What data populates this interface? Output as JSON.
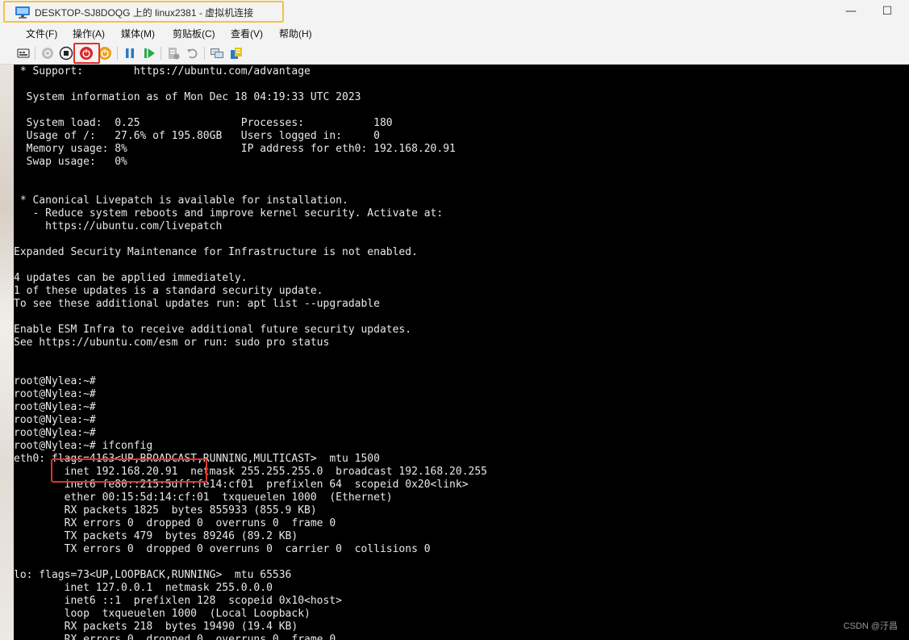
{
  "window": {
    "title": "DESKTOP-SJ8DOQG 上的 linux2381 - 虚拟机连接",
    "controls": {
      "minimize": "—",
      "maximize": "☐"
    }
  },
  "menu": [
    "文件(F)",
    "操作(A)",
    "媒体(M)",
    "剪贴板(C)",
    "查看(V)",
    "帮助(H)"
  ],
  "toolbar": {
    "buttons": [
      "ctrl-alt-del-icon",
      "start-icon",
      "turn-off-icon",
      "shutdown-icon",
      "save-icon",
      "pause-icon",
      "resume-icon",
      "checkpoint-icon",
      "revert-icon",
      "enhanced-session-icon",
      "share-icon"
    ],
    "colors": {
      "shutdown_red": "#d8262b",
      "save_orange": "#e8a21a",
      "pause_blue": "#2a78c8",
      "resume_green": "#2aa84a"
    }
  },
  "terminal": {
    "lines": [
      " * Support:        https://ubuntu.com/advantage",
      "",
      "  System information as of Mon Dec 18 04:19:33 UTC 2023",
      "",
      "  System load:  0.25                Processes:           180",
      "  Usage of /:   27.6% of 195.80GB   Users logged in:     0",
      "  Memory usage: 8%                  IP address for eth0: 192.168.20.91",
      "  Swap usage:   0%",
      "",
      "",
      " * Canonical Livepatch is available for installation.",
      "   - Reduce system reboots and improve kernel security. Activate at:",
      "     https://ubuntu.com/livepatch",
      "",
      "Expanded Security Maintenance for Infrastructure is not enabled.",
      "",
      "4 updates can be applied immediately.",
      "1 of these updates is a standard security update.",
      "To see these additional updates run: apt list --upgradable",
      "",
      "Enable ESM Infra to receive additional future security updates.",
      "See https://ubuntu.com/esm or run: sudo pro status",
      "",
      "",
      "root@Nylea:~#",
      "root@Nylea:~#",
      "root@Nylea:~#",
      "root@Nylea:~#",
      "root@Nylea:~#",
      "root@Nylea:~# ifconfig",
      "eth0: flags=4163<UP,BROADCAST,RUNNING,MULTICAST>  mtu 1500",
      "        inet 192.168.20.91  netmask 255.255.255.0  broadcast 192.168.20.255",
      "        inet6 fe80::215:5dff:fe14:cf01  prefixlen 64  scopeid 0x20<link>",
      "        ether 00:15:5d:14:cf:01  txqueuelen 1000  (Ethernet)",
      "        RX packets 1825  bytes 855933 (855.9 KB)",
      "        RX errors 0  dropped 0  overruns 0  frame 0",
      "        TX packets 479  bytes 89246 (89.2 KB)",
      "        TX errors 0  dropped 0 overruns 0  carrier 0  collisions 0",
      "",
      "lo: flags=73<UP,LOOPBACK,RUNNING>  mtu 65536",
      "        inet 127.0.0.1  netmask 255.0.0.0",
      "        inet6 ::1  prefixlen 128  scopeid 0x10<host>",
      "        loop  txqueuelen 1000  (Local Loopback)",
      "        RX packets 218  bytes 19490 (19.4 KB)",
      "        RX errors 0  dropped 0  overruns 0  frame 0"
    ]
  },
  "watermark": "CSDN @汙昌"
}
